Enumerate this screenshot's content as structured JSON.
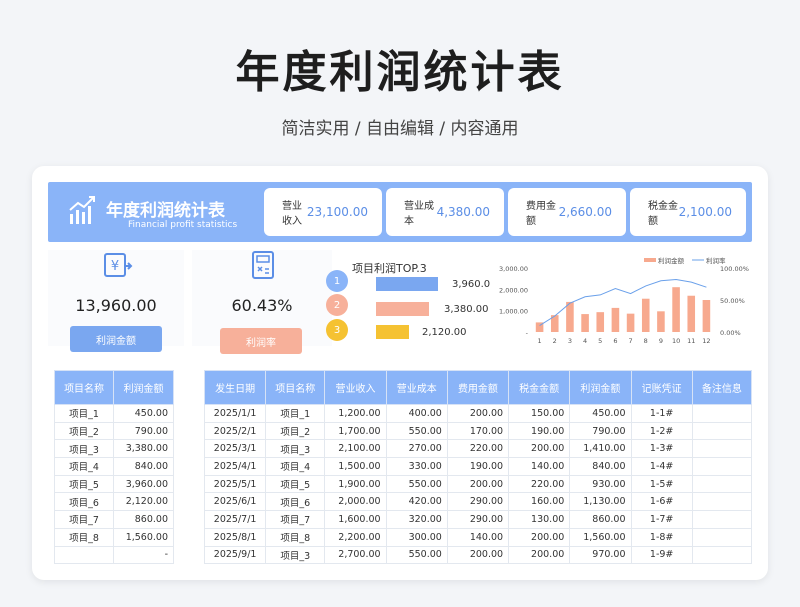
{
  "hero": {
    "title": "年度利润统计表",
    "subtitle": "简洁实用 / 自由编辑 / 内容通用"
  },
  "banner": {
    "title": "年度利润统计表",
    "subtitle_en": "Financial profit statistics",
    "icon": "chart-trend-icon"
  },
  "kpis": [
    {
      "label": "营业收入",
      "value": "23,100.00"
    },
    {
      "label": "营业成本",
      "value": "4,380.00"
    },
    {
      "label": "费用金额",
      "value": "2,660.00"
    },
    {
      "label": "税金金额",
      "value": "2,100.00"
    }
  ],
  "stats": {
    "profit": {
      "value": "13,960.00",
      "label": "利润金额",
      "icon": "yen-transfer-icon"
    },
    "rate": {
      "value": "60.43%",
      "label": "利润率",
      "icon": "calculator-icon"
    }
  },
  "top3": {
    "title": "项目利润TOP.3",
    "items": [
      {
        "rank": "1",
        "value": 3960,
        "label": "3,960.0"
      },
      {
        "rank": "2",
        "value": 3380,
        "label": "3,380.00"
      },
      {
        "rank": "3",
        "value": 2120,
        "label": "2,120.00"
      }
    ]
  },
  "chart_data": {
    "type": "bar",
    "categories": [
      "1",
      "2",
      "3",
      "4",
      "5",
      "6",
      "7",
      "8",
      "9",
      "10",
      "11",
      "12"
    ],
    "series": [
      {
        "name": "利润金额",
        "type": "bar",
        "axis": "left",
        "values": [
          450,
          790,
          1410,
          840,
          930,
          1130,
          860,
          1560,
          970,
          2100,
          1700,
          1500
        ]
      },
      {
        "name": "利润率",
        "type": "line",
        "axis": "right",
        "values": [
          0.1,
          0.25,
          0.45,
          0.55,
          0.58,
          0.68,
          0.6,
          0.72,
          0.8,
          0.82,
          0.78,
          0.7
        ]
      }
    ],
    "y_left": {
      "ticks": [
        "3,000.00",
        "2,000.00",
        "1,000.00",
        "-"
      ],
      "range": [
        0,
        3000
      ]
    },
    "y_right": {
      "ticks": [
        "100.00%",
        "50.00%",
        "0.00%"
      ],
      "range": [
        0,
        1
      ]
    },
    "legend": "top-right",
    "colors": {
      "bar": "#f7a98e",
      "line": "#6aa0ea"
    }
  },
  "left_table": {
    "headers": [
      "项目名称",
      "利润金额"
    ],
    "rows": [
      [
        "项目_1",
        "450.00"
      ],
      [
        "项目_2",
        "790.00"
      ],
      [
        "项目_3",
        "3,380.00"
      ],
      [
        "项目_4",
        "840.00"
      ],
      [
        "项目_5",
        "3,960.00"
      ],
      [
        "项目_6",
        "2,120.00"
      ],
      [
        "项目_7",
        "860.00"
      ],
      [
        "项目_8",
        "1,560.00"
      ],
      [
        "",
        "-"
      ]
    ]
  },
  "main_table": {
    "headers": [
      "发生日期",
      "项目名称",
      "营业收入",
      "营业成本",
      "费用金额",
      "税金金额",
      "利润金额",
      "记账凭证",
      "备注信息"
    ],
    "rows": [
      [
        "2025/1/1",
        "项目_1",
        "1,200.00",
        "400.00",
        "200.00",
        "150.00",
        "450.00",
        "1-1#",
        ""
      ],
      [
        "2025/2/1",
        "项目_2",
        "1,700.00",
        "550.00",
        "170.00",
        "190.00",
        "790.00",
        "1-2#",
        ""
      ],
      [
        "2025/3/1",
        "项目_3",
        "2,100.00",
        "270.00",
        "220.00",
        "200.00",
        "1,410.00",
        "1-3#",
        ""
      ],
      [
        "2025/4/1",
        "项目_4",
        "1,500.00",
        "330.00",
        "190.00",
        "140.00",
        "840.00",
        "1-4#",
        ""
      ],
      [
        "2025/5/1",
        "项目_5",
        "1,900.00",
        "550.00",
        "200.00",
        "220.00",
        "930.00",
        "1-5#",
        ""
      ],
      [
        "2025/6/1",
        "项目_6",
        "2,000.00",
        "420.00",
        "290.00",
        "160.00",
        "1,130.00",
        "1-6#",
        ""
      ],
      [
        "2025/7/1",
        "项目_7",
        "1,600.00",
        "320.00",
        "290.00",
        "130.00",
        "860.00",
        "1-7#",
        ""
      ],
      [
        "2025/8/1",
        "项目_8",
        "2,200.00",
        "300.00",
        "140.00",
        "200.00",
        "1,560.00",
        "1-8#",
        ""
      ],
      [
        "2025/9/1",
        "项目_3",
        "2,700.00",
        "550.00",
        "200.00",
        "200.00",
        "970.00",
        "1-9#",
        ""
      ]
    ]
  }
}
